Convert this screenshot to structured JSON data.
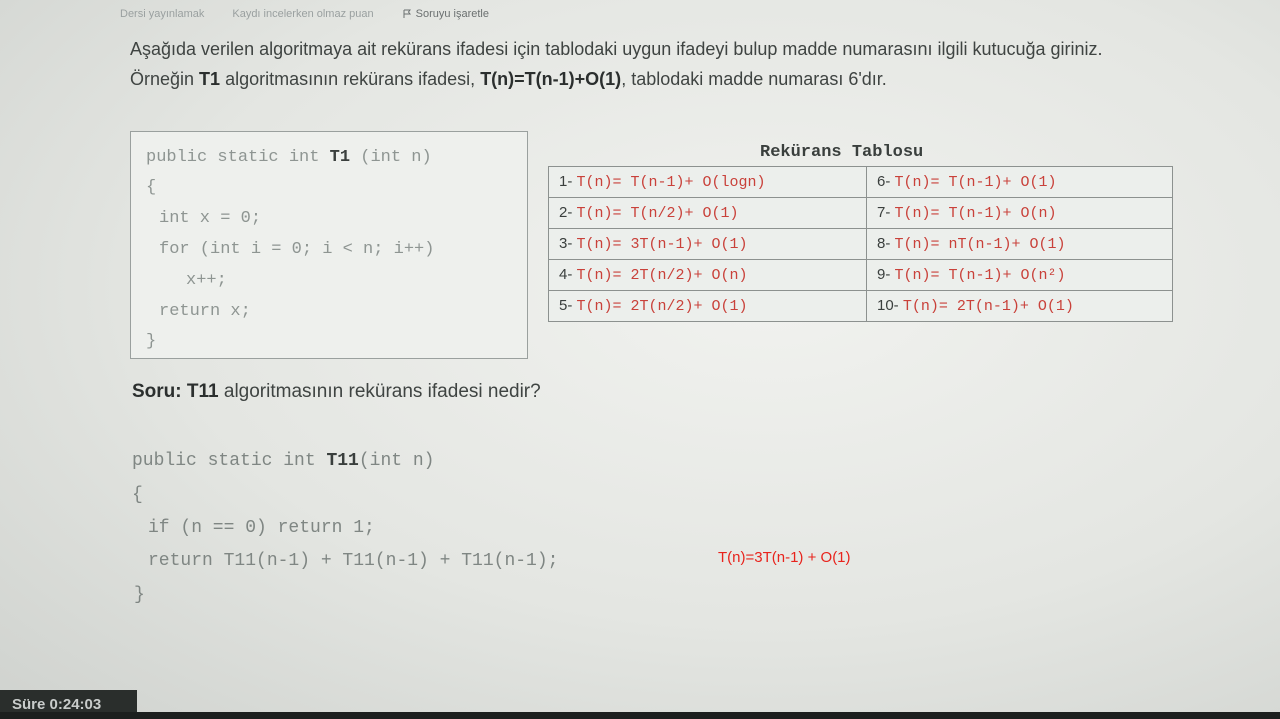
{
  "top_nav": {
    "item1": "Dersi yayınlamak",
    "item2": "Kaydı incelerken olmaz puan",
    "flag_label": "Soruyu işaretle"
  },
  "intro": {
    "part1": "Aşağıda verilen algoritmaya ait rekürans ifadesi için tablodaki uygun ifadeyi bulup madde numarasını ilgili kutucuğa giriniz. Örneğin ",
    "t1": "T1",
    "part2": " algoritmasının rekürans ifadesi, ",
    "example": "T(n)=T(n-1)+O(1)",
    "part3": ", tablodaki madde numarası 6'dır."
  },
  "example_code": {
    "l1_pre": "public static int ",
    "l1_name": "T1",
    "l1_post": " (int n)",
    "l2": "{",
    "l3": "int x = 0;",
    "l4": "for (int i = 0; i < n; i++)",
    "l5": "x++;",
    "l6": "return x;",
    "l7": "}"
  },
  "table": {
    "title": "Rekürans Tablosu",
    "rows": [
      {
        "ln": "1-",
        "le": "T(n)= T(n-1)+ O(logn)",
        "rn": "6-",
        "re": "T(n)= T(n-1)+ O(1)"
      },
      {
        "ln": "2-",
        "le": "T(n)= T(n/2)+ O(1)",
        "rn": "7-",
        "re": "T(n)= T(n-1)+ O(n)"
      },
      {
        "ln": "3-",
        "le": "T(n)= 3T(n-1)+ O(1)",
        "rn": "8-",
        "re": "T(n)= nT(n-1)+ O(1)"
      },
      {
        "ln": "4-",
        "le": "T(n)= 2T(n/2)+ O(n)",
        "rn": "9-",
        "re": "T(n)= T(n-1)+ O(n²)"
      },
      {
        "ln": "5-",
        "le": "T(n)= 2T(n/2)+ O(1)",
        "rn": "10-",
        "re": "T(n)= 2T(n-1)+ O(1)"
      }
    ]
  },
  "question": {
    "label": "Soru:",
    "name": "T11",
    "text": " algoritmasının rekürans ifadesi nedir?"
  },
  "question_code": {
    "l1_pre": "public static int ",
    "l1_name": "T11",
    "l1_post": "(int n)",
    "l2": "{",
    "l3": "if (n == 0) return 1;",
    "l4": "return T11(n-1) + T11(n-1) + T11(n-1);",
    "l5": "}"
  },
  "answer": "T(n)=3T(n-1) + O(1)",
  "timer": "Süre 0:24:03"
}
